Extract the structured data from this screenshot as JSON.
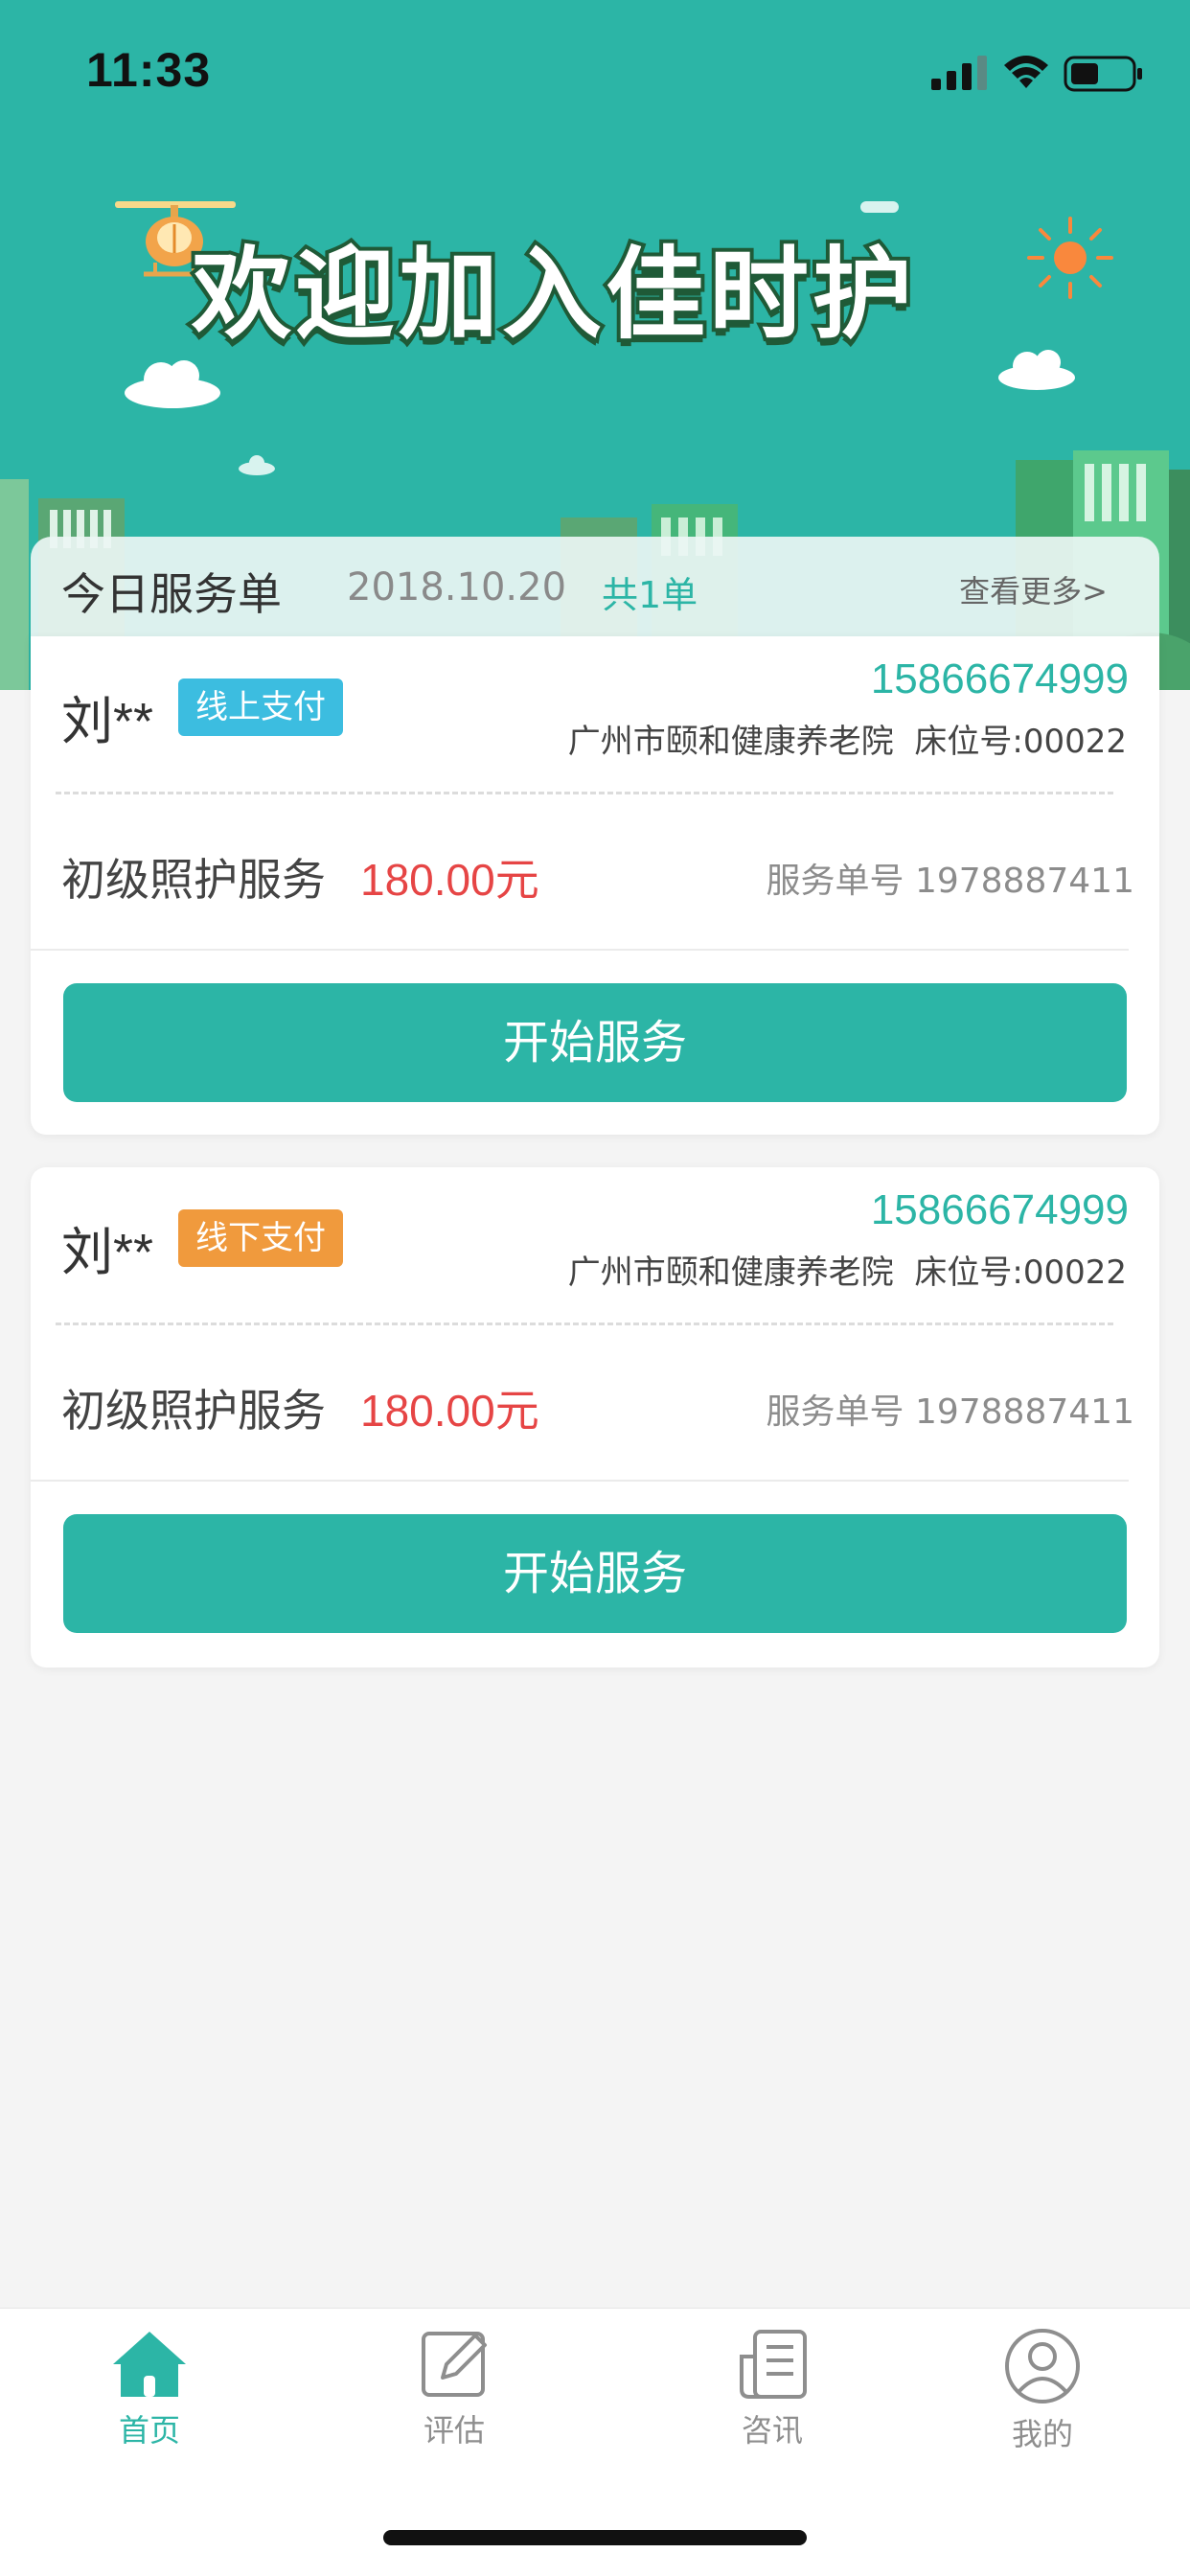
{
  "status_bar": {
    "time": "11:33"
  },
  "banner": {
    "title": "欢迎加入佳时护"
  },
  "summary": {
    "title": "今日服务单",
    "date": "2018.10.20",
    "count": "共1单",
    "more": "查看更多>"
  },
  "orders": [
    {
      "name": "刘**",
      "payment": "线上支付",
      "phone": "15866674999",
      "address": "广州市颐和健康养老院",
      "bed": "床位号:00022",
      "service": "初级照护服务",
      "price": "180.00元",
      "order_no": "服务单号 1978887411",
      "action": "开始服务"
    },
    {
      "name": "刘**",
      "payment": "线下支付",
      "phone": "15866674999",
      "address": "广州市颐和健康养老院",
      "bed": "床位号:00022",
      "service": "初级照护服务",
      "price": "180.00元",
      "order_no": "服务单号 1978887411",
      "action": "开始服务"
    }
  ],
  "tabs": [
    {
      "label": "首页",
      "icon": "home-icon",
      "active": true
    },
    {
      "label": "评估",
      "icon": "edit-icon",
      "active": false
    },
    {
      "label": "咨讯",
      "icon": "news-icon",
      "active": false
    },
    {
      "label": "我的",
      "icon": "user-icon",
      "active": false
    }
  ],
  "colors": {
    "primary": "#2cb5a6",
    "price": "#e64545",
    "online_tag": "#3cbde0",
    "offline_tag": "#f09a3d"
  }
}
